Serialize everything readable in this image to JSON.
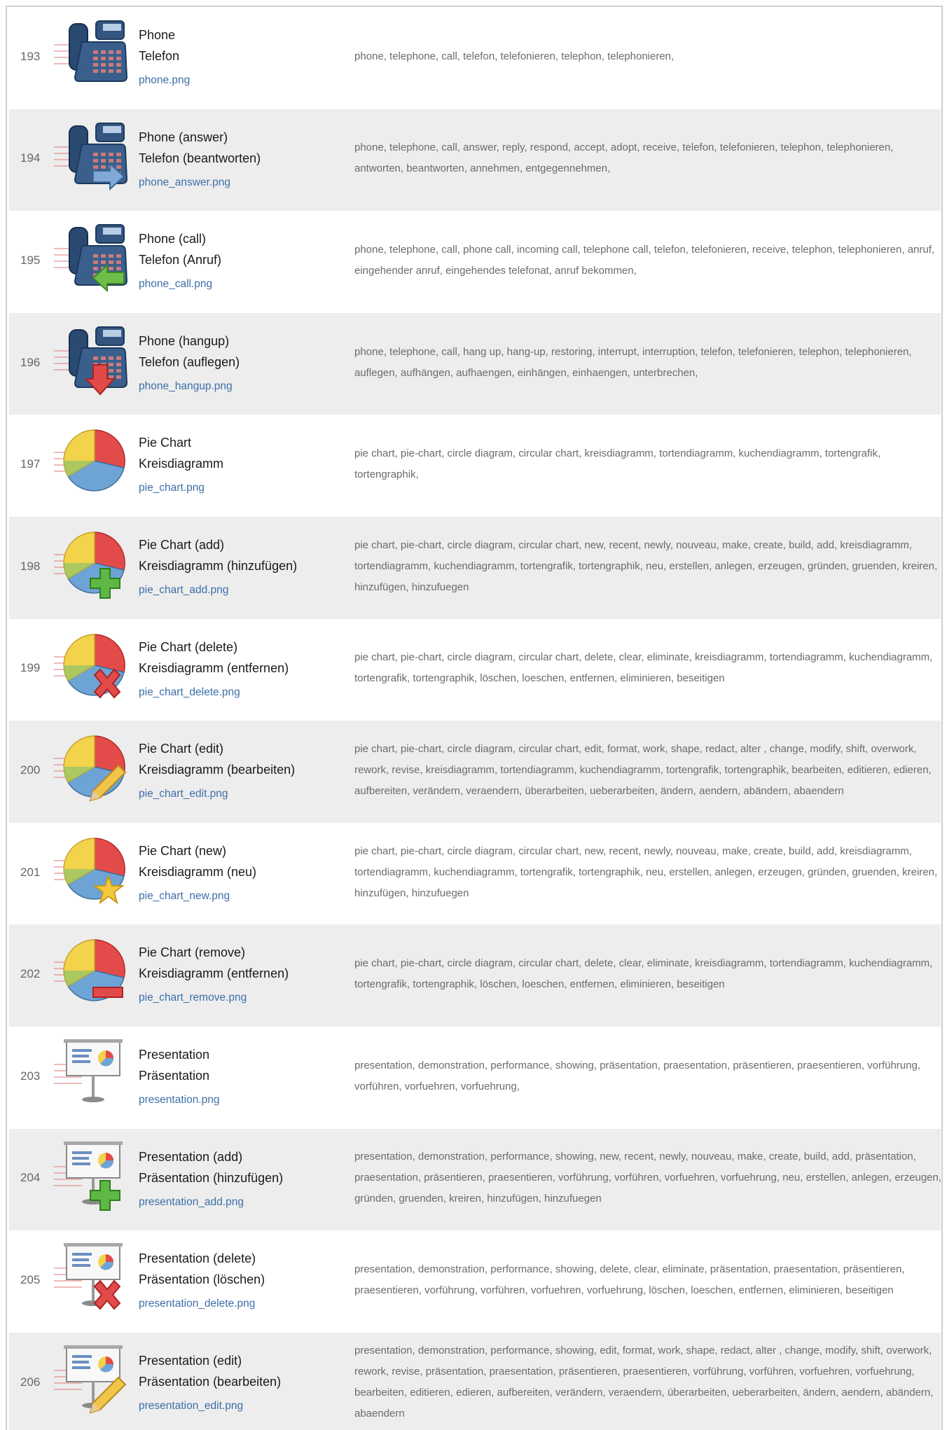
{
  "rows": [
    {
      "num": "193",
      "name_en": "Phone",
      "name_de": "Telefon",
      "file": "phone.png",
      "icon": "phone-icon",
      "keywords": "phone, telephone, call, telefon, telefonieren, telephon, telephonieren,"
    },
    {
      "num": "194",
      "name_en": "Phone (answer)",
      "name_de": "Telefon (beantworten)",
      "file": "phone_answer.png",
      "icon": "phone-answer-icon",
      "keywords": "phone, telephone, call, answer, reply, respond, accept, adopt, receive, telefon, telefonieren, telephon, telephonieren, antworten, beantworten, annehmen, entgegennehmen,"
    },
    {
      "num": "195",
      "name_en": "Phone (call)",
      "name_de": "Telefon (Anruf)",
      "file": "phone_call.png",
      "icon": "phone-call-icon",
      "keywords": "phone, telephone, call, phone call, incoming call, telephone call, telefon, telefonieren, receive, telephon, telephonieren, anruf, eingehender anruf, eingehendes telefonat, anruf bekommen,"
    },
    {
      "num": "196",
      "name_en": "Phone (hangup)",
      "name_de": "Telefon (auflegen)",
      "file": "phone_hangup.png",
      "icon": "phone-hangup-icon",
      "keywords": "phone, telephone, call, hang up, hang-up, restoring, interrupt, interruption, telefon, telefonieren, telephon, telephonieren, auflegen, aufhängen, aufhaengen, einhängen, einhaengen, unterbrechen,"
    },
    {
      "num": "197",
      "name_en": "Pie Chart",
      "name_de": "Kreisdiagramm",
      "file": "pie_chart.png",
      "icon": "pie-chart-icon",
      "keywords": "pie chart, pie-chart, circle diagram, circular chart, kreisdiagramm, tortendiagramm, kuchendiagramm, tortengrafik, tortengraphik,"
    },
    {
      "num": "198",
      "name_en": "Pie Chart (add)",
      "name_de": "Kreisdiagramm (hinzufügen)",
      "file": "pie_chart_add.png",
      "icon": "pie-chart-add-icon",
      "keywords": "pie chart, pie-chart, circle diagram, circular chart, new, recent, newly, nouveau, make, create, build, add, kreisdiagramm, tortendiagramm, kuchendiagramm, tortengrafik, tortengraphik, neu, erstellen, anlegen, erzeugen, gründen, gruenden, kreiren, hinzufügen, hinzufuegen"
    },
    {
      "num": "199",
      "name_en": "Pie Chart (delete)",
      "name_de": "Kreisdiagramm (entfernen)",
      "file": "pie_chart_delete.png",
      "icon": "pie-chart-delete-icon",
      "keywords": "pie chart, pie-chart, circle diagram, circular chart, delete, clear, eliminate, kreisdiagramm, tortendiagramm, kuchendiagramm, tortengrafik, tortengraphik, löschen, loeschen, entfernen, eliminieren, beseitigen"
    },
    {
      "num": "200",
      "name_en": "Pie Chart (edit)",
      "name_de": "Kreisdiagramm (bearbeiten)",
      "file": "pie_chart_edit.png",
      "icon": "pie-chart-edit-icon",
      "keywords": "pie chart, pie-chart, circle diagram, circular chart, edit, format, work, shape, redact, alter , change, modify, shift, overwork, rework, revise, kreisdiagramm, tortendiagramm, kuchendiagramm, tortengrafik, tortengraphik, bearbeiten, editieren, edieren, aufbereiten, verändern, veraendern, überarbeiten, ueberarbeiten, ändern, aendern, abändern, abaendern"
    },
    {
      "num": "201",
      "name_en": "Pie Chart (new)",
      "name_de": "Kreisdiagramm (neu)",
      "file": "pie_chart_new.png",
      "icon": "pie-chart-new-icon",
      "keywords": "pie chart, pie-chart, circle diagram, circular chart, new, recent, newly, nouveau, make, create, build, add, kreisdiagramm, tortendiagramm, kuchendiagramm, tortengrafik, tortengraphik, neu, erstellen, anlegen, erzeugen, gründen, gruenden, kreiren, hinzufügen, hinzufuegen"
    },
    {
      "num": "202",
      "name_en": "Pie Chart (remove)",
      "name_de": "Kreisdiagramm (entfernen)",
      "file": "pie_chart_remove.png",
      "icon": "pie-chart-remove-icon",
      "keywords": "pie chart, pie-chart, circle diagram, circular chart, delete, clear, eliminate, kreisdiagramm, tortendiagramm, kuchendiagramm, tortengrafik, tortengraphik, löschen, loeschen, entfernen, eliminieren, beseitigen"
    },
    {
      "num": "203",
      "name_en": "Presentation",
      "name_de": "Präsentation",
      "file": "presentation.png",
      "icon": "presentation-icon",
      "keywords": "presentation, demonstration, performance, showing, präsentation, praesentation, präsentieren, praesentieren, vorführung, vorführen, vorfuehren, vorfuehrung,"
    },
    {
      "num": "204",
      "name_en": "Presentation (add)",
      "name_de": "Präsentation (hinzufügen)",
      "file": "presentation_add.png",
      "icon": "presentation-add-icon",
      "keywords": "presentation, demonstration, performance, showing, new, recent, newly, nouveau, make, create, build, add, präsentation, praesentation, präsentieren, praesentieren, vorführung, vorführen, vorfuehren, vorfuehrung, neu, erstellen, anlegen, erzeugen, gründen, gruenden, kreiren, hinzufügen, hinzufuegen"
    },
    {
      "num": "205",
      "name_en": "Presentation (delete)",
      "name_de": "Präsentation (löschen)",
      "file": "presentation_delete.png",
      "icon": "presentation-delete-icon",
      "keywords": "presentation, demonstration, performance, showing, delete, clear, eliminate, präsentation, praesentation, präsentieren, praesentieren, vorführung, vorführen, vorfuehren, vorfuehrung, löschen, loeschen, entfernen, eliminieren, beseitigen"
    },
    {
      "num": "206",
      "name_en": "Presentation (edit)",
      "name_de": "Präsentation (bearbeiten)",
      "file": "presentation_edit.png",
      "icon": "presentation-edit-icon",
      "keywords": "presentation, demonstration, performance, showing, edit, format, work, shape, redact, alter , change, modify, shift, overwork, rework, revise, präsentation, praesentation, präsentieren, praesentieren, vorführung, vorführen, vorfuehren, vorfuehrung, bearbeiten, editieren, edieren, aufbereiten, verändern, veraendern, überarbeiten, ueberarbeiten, ändern, aendern, abändern, abaendern"
    }
  ]
}
